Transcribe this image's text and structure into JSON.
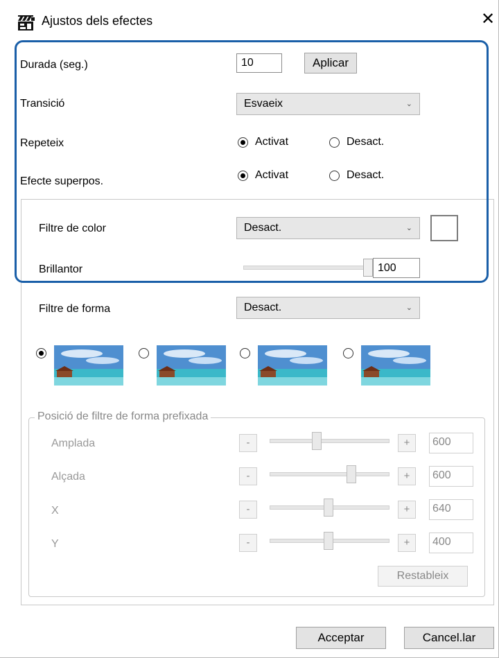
{
  "window": {
    "title": "Ajustos dels efectes",
    "app_icon": "clapperboard-icon",
    "close_icon": "close-icon",
    "close_glyph": "✕"
  },
  "highlight_color": "#1a5fa8",
  "duration": {
    "label": "Durada (seg.)",
    "value": "10",
    "apply_label": "Aplicar"
  },
  "transition": {
    "label": "Transició",
    "selected": "Esvaeix"
  },
  "repeat": {
    "label": "Repeteix",
    "on_label": "Activat",
    "off_label": "Desact.",
    "selected": "on"
  },
  "overlay": {
    "label": "Efecte superpos.",
    "on_label": "Activat",
    "off_label": "Desact.",
    "selected": "on"
  },
  "color_filter": {
    "label": "Filtre de color",
    "selected": "Desact.",
    "swatch_color": "#ffffff"
  },
  "brightness": {
    "label": "Brillantor",
    "value": "100"
  },
  "shape_filter": {
    "label": "Filtre de forma",
    "selected": "Desact.",
    "shapes_selected_index": 0
  },
  "preset": {
    "title": "Posició de filtre de forma prefixada",
    "minus": "-",
    "plus": "+",
    "rows": [
      {
        "label": "Amplada",
        "value": "600"
      },
      {
        "label": "Alçada",
        "value": "600"
      },
      {
        "label": "X",
        "value": "640"
      },
      {
        "label": "Y",
        "value": "400"
      }
    ],
    "reset_label": "Restableix"
  },
  "footer": {
    "ok_label": "Acceptar",
    "cancel_label": "Cancel.lar"
  }
}
